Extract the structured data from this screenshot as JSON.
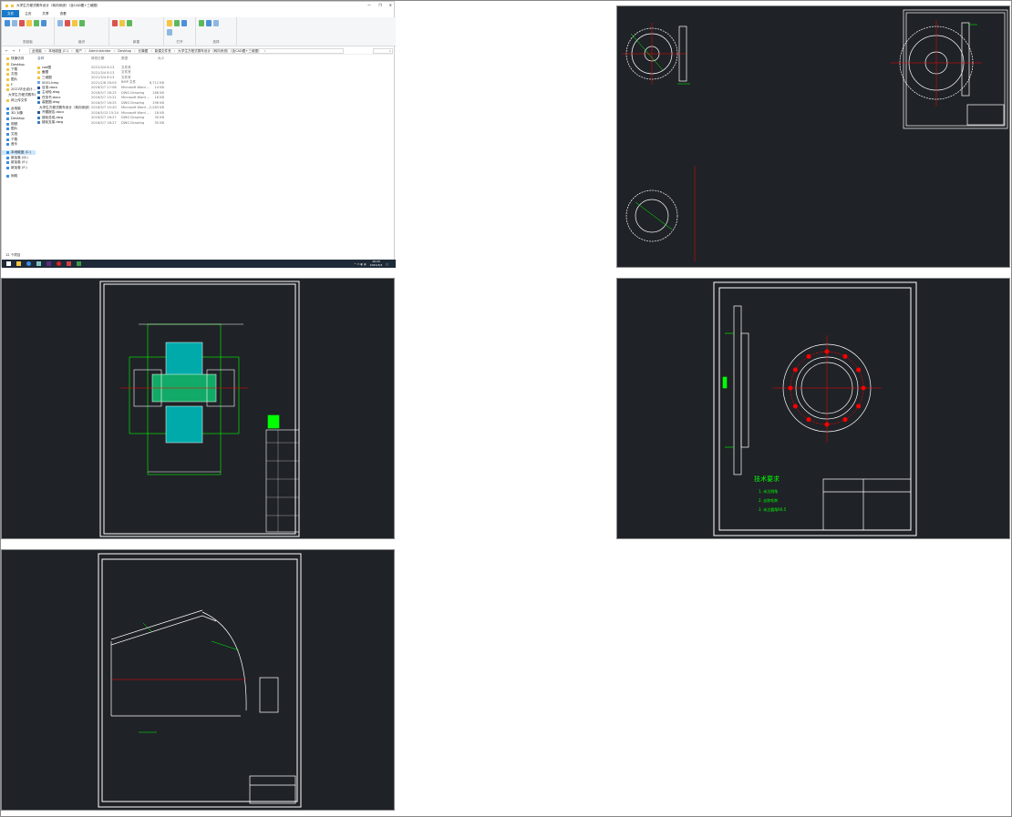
{
  "explorer": {
    "title": "大学生方程式赛车设计（转向系统）（含CAD图+三维图）",
    "window_controls": [
      "—",
      "❐",
      "✕"
    ],
    "tabs": [
      "文件",
      "主页",
      "共享",
      "查看"
    ],
    "ribbon_groups": [
      {
        "label": "剪贴板",
        "items": [
          "固定到快速访问",
          "复制",
          "粘贴",
          "剪切",
          "复制路径",
          "粘贴快捷方式"
        ]
      },
      {
        "label": "组织",
        "items": [
          "移动到",
          "复制到",
          "删除",
          "重命名"
        ]
      },
      {
        "label": "新建",
        "items": [
          "新建文件夹",
          "新建项目",
          "轻松访问"
        ]
      },
      {
        "label": "打开",
        "items": [
          "属性",
          "打开",
          "编辑",
          "历史记录"
        ]
      },
      {
        "label": "选择",
        "items": [
          "全部选择",
          "全部取消",
          "反向选择"
        ]
      }
    ],
    "breadcrumb": [
      "此电脑",
      "本地磁盘 (C:)",
      "用户",
      "Administrator",
      "Desktop",
      "长篇图",
      "新建文件夹",
      "大学生方程式赛车设计（转向系统）（含CAD图+三维图）"
    ],
    "search_placeholder": "",
    "sidebar": [
      "快速访问",
      "Desktop",
      "下载",
      "文档",
      "图片",
      "F",
      "2021毕业设计...",
      "大学生方程式赛车设计",
      "网上传文件",
      "此电脑",
      "3D 对象",
      "Desktop",
      "视频",
      "图片",
      "文档",
      "下载",
      "音乐",
      "本地磁盘 (C:)",
      "新加卷 (D:)",
      "新加卷 (E:)",
      "新加卷 (F:)",
      "网络"
    ],
    "sidebar_selected": 17,
    "columns": [
      "名称",
      "修改日期",
      "类型",
      "大小"
    ],
    "files": [
      {
        "name": "cad图",
        "date": "2021/3/4 8:13",
        "type": "文件夹",
        "size": "",
        "icon": "folder"
      },
      {
        "name": "截图",
        "date": "2021/3/4 8:13",
        "type": "文件夹",
        "size": "",
        "icon": "folder"
      },
      {
        "name": "三维图",
        "date": "2021/3/4 8:13",
        "type": "文件夹",
        "size": "",
        "icon": "folder"
      },
      {
        "name": "0001.bmp",
        "date": "2021/2/8 16:03",
        "type": "BMP 文件",
        "size": "8,712 KB",
        "icon": "image"
      },
      {
        "name": "目录.docx",
        "date": "2016/5/7 17:06",
        "type": "Microsoft Word ...",
        "size": "14 KB",
        "icon": "word"
      },
      {
        "name": "主动轮.dwg",
        "date": "2016/5/7 18:25",
        "type": "DWG Drawing",
        "size": "186 KB",
        "icon": "dwg"
      },
      {
        "name": "任务书.docx",
        "date": "2016/5/7 15:21",
        "type": "Microsoft Word ...",
        "size": "18 KB",
        "icon": "word"
      },
      {
        "name": "装配图.dwg",
        "date": "2016/5/7 18:25",
        "type": "DWG Drawing",
        "size": "196 KB",
        "icon": "dwg"
      },
      {
        "name": "大学生方程式赛车设计（转向系统）...",
        "date": "2016/5/7 15:20",
        "type": "Microsoft Word ...",
        "size": "2,283 KB",
        "icon": "word"
      },
      {
        "name": "开题报告.docx",
        "date": "2016/5/13 15:24",
        "type": "Microsoft Word ...",
        "size": "18 KB",
        "icon": "word"
      },
      {
        "name": "链轮总成.dwg",
        "date": "2016/5/7 18:27",
        "type": "DWG Drawing",
        "size": "30 KB",
        "icon": "dwg"
      },
      {
        "name": "链轮支架.dwg",
        "date": "2016/5/7 18:27",
        "type": "DWG Drawing",
        "size": "35 KB",
        "icon": "dwg"
      }
    ],
    "status": "12 个项目",
    "clock": {
      "time": "16:29",
      "date": "2021/3/4"
    }
  },
  "cad": {
    "flange_notes": {
      "title": "技术要求",
      "lines": [
        "1. 未注倒角",
        "2. 去除毛刺",
        "3. 未注圆角R0.5"
      ]
    },
    "colors": {
      "bg": "#1f2227",
      "line": "#ffffff",
      "green": "#00ff00",
      "red": "#ff0000",
      "cyan": "#00ffff"
    }
  }
}
